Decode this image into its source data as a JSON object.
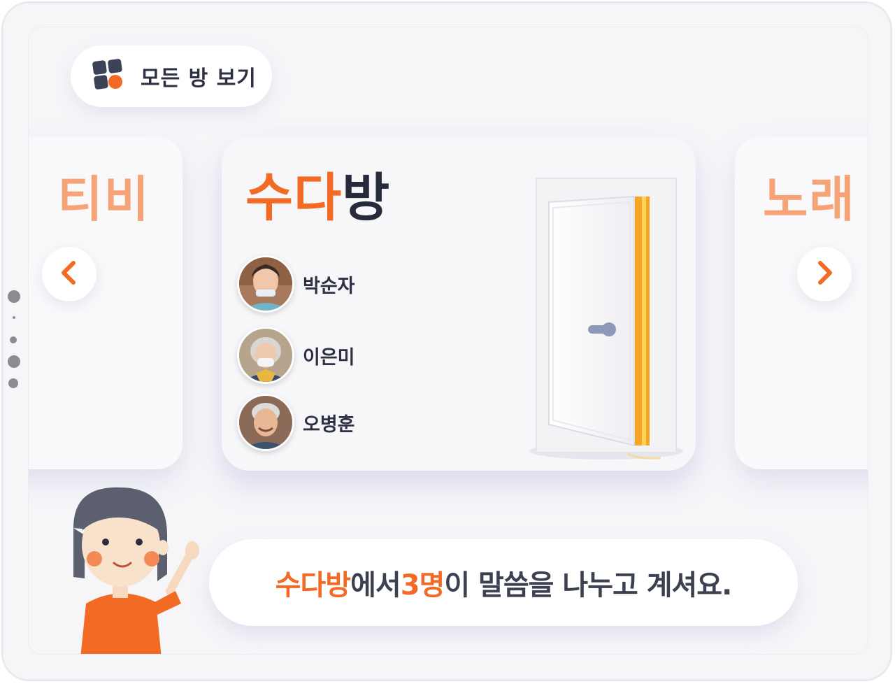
{
  "header": {
    "all_rooms_label": "모든 방 보기"
  },
  "carousel": {
    "prev_room": "티비",
    "next_room": "노래",
    "current_room": {
      "title_part1": "수다",
      "title_part2": "방",
      "members": [
        {
          "name": "박순자"
        },
        {
          "name": "이은미"
        },
        {
          "name": "오병훈"
        }
      ]
    }
  },
  "message": {
    "room": "수다방",
    "text1": "에서 ",
    "count": "3명",
    "text2": "이 말씀을 나누고 계셔요."
  },
  "colors": {
    "accent": "#f26a24",
    "accent_light": "#f6a378",
    "text_dark": "#262a3a",
    "background": "#f6f6f9"
  }
}
